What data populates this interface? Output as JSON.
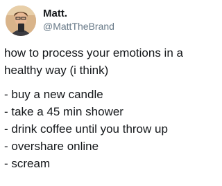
{
  "tweet": {
    "author": {
      "display_name": "Matt.",
      "handle": "@MattTheBrand"
    },
    "intro_lines": [
      "how to process your emotions in a",
      "healthy way (i think)"
    ],
    "list_items": [
      "- buy a new candle",
      "- take a 45 min shower",
      "- drink coffee until you throw up",
      "- overshare online",
      "- scream"
    ]
  },
  "colors": {
    "text_primary": "#14171a",
    "text_secondary": "#657786",
    "background": "#ffffff"
  },
  "icons": {
    "avatar": "profile-photo-avatar"
  }
}
